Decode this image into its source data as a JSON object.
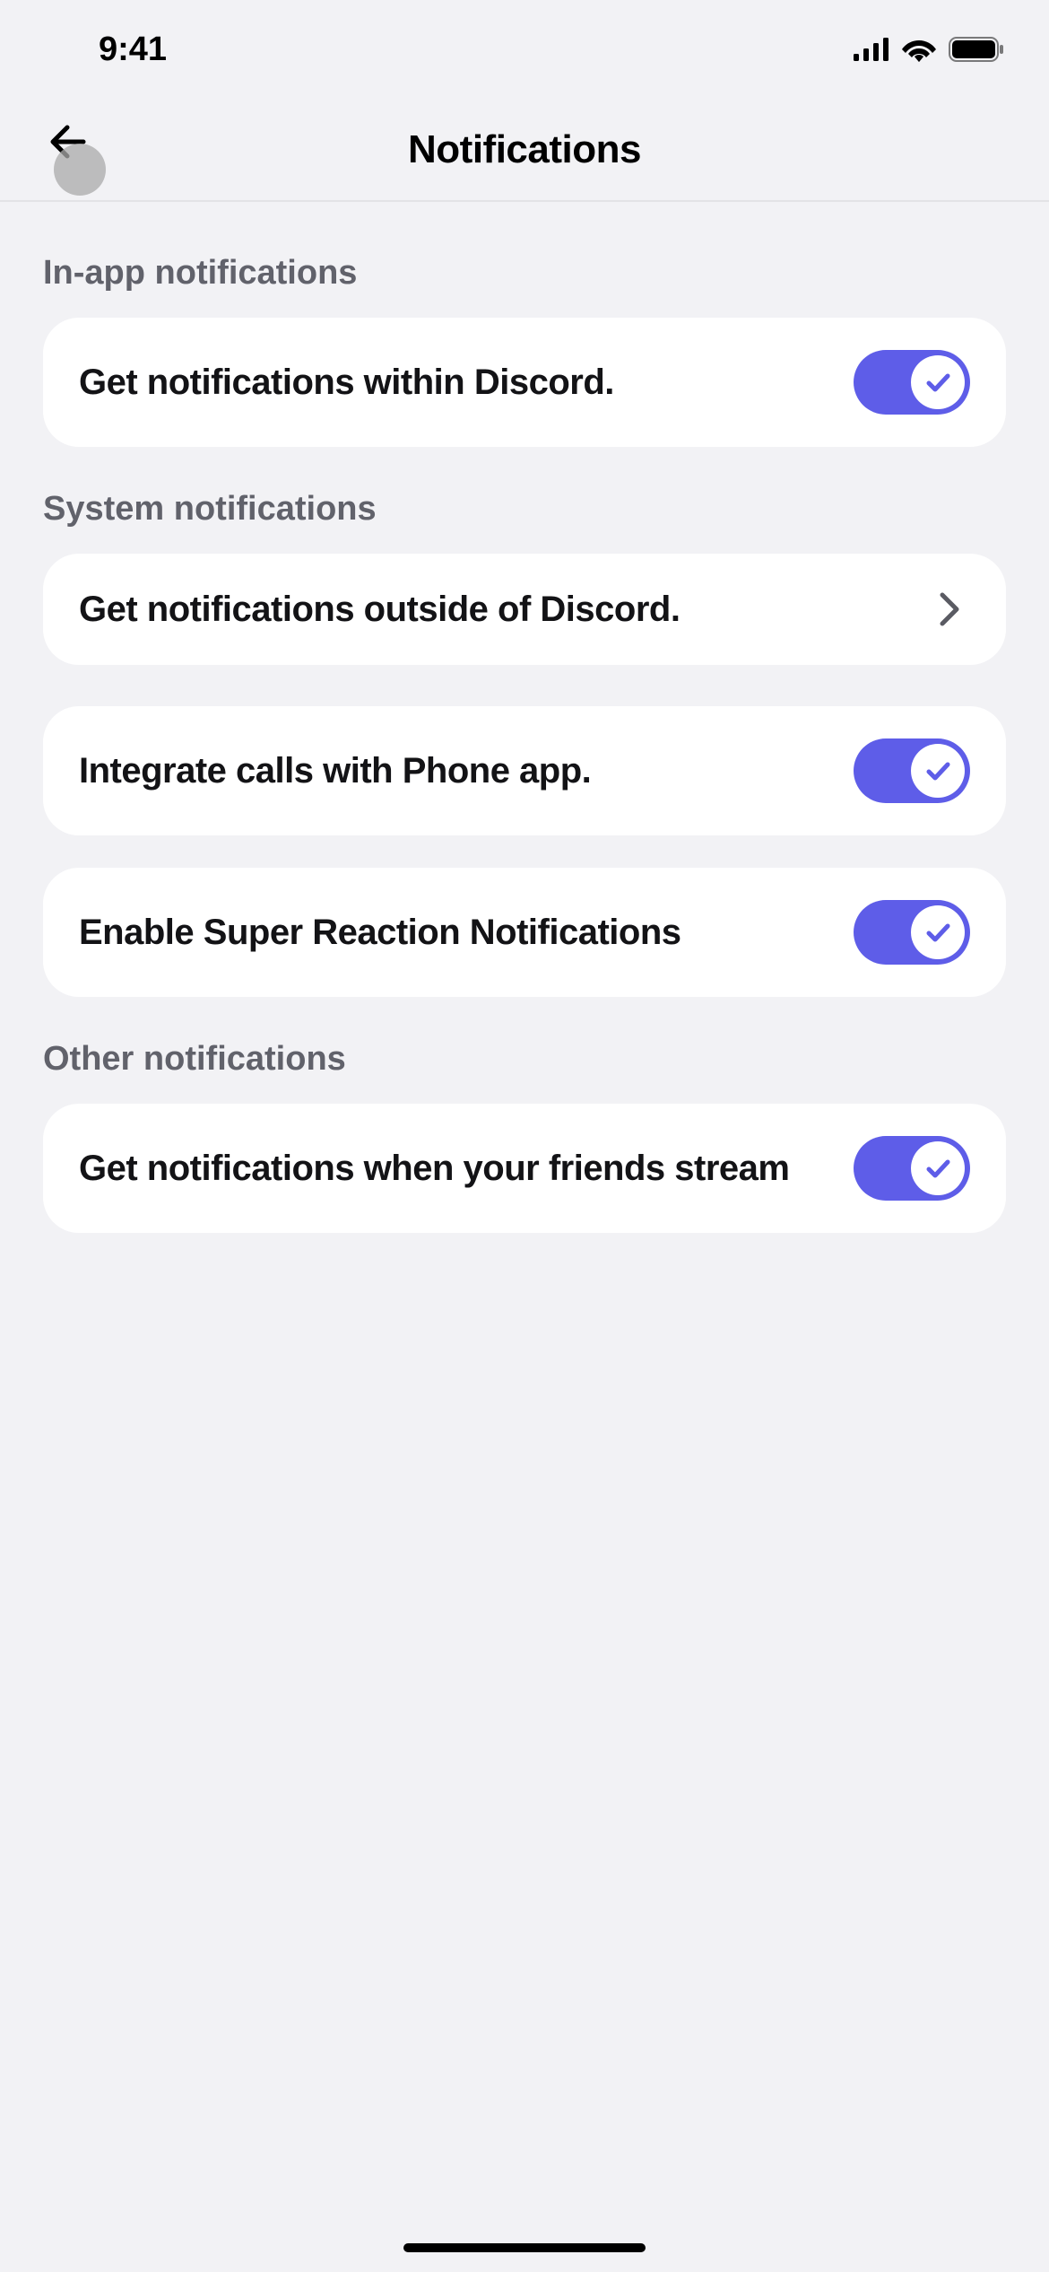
{
  "statusBar": {
    "time": "9:41"
  },
  "header": {
    "title": "Notifications"
  },
  "sections": [
    {
      "title": "In-app notifications",
      "items": [
        {
          "label": "Get notifications within Discord.",
          "type": "toggle",
          "on": true
        }
      ]
    },
    {
      "title": "System notifications",
      "items": [
        {
          "label": "Get notifications outside of Discord.",
          "type": "link"
        },
        {
          "label": "Integrate calls with Phone app.",
          "type": "toggle",
          "on": true
        },
        {
          "label": "Enable Super Reaction Notifications",
          "type": "toggle",
          "on": true
        }
      ]
    },
    {
      "title": "Other notifications",
      "items": [
        {
          "label": "Get notifications when your friends stream",
          "type": "toggle",
          "on": true
        }
      ]
    }
  ]
}
